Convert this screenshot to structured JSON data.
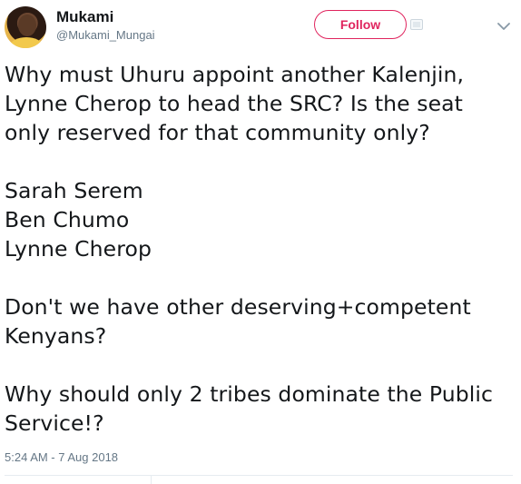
{
  "user": {
    "name": "Mukami",
    "handle": "@Mukami_Mungai"
  },
  "actions": {
    "follow_label": "Follow"
  },
  "tweet": {
    "lines": [
      "Why must Uhuru appoint another Kalenjin,",
      "Lynne Cherop to head the SRC?  Is the seat",
      "only reserved for that community only?",
      "Sarah Serem",
      "Ben Chumo",
      "Lynne Cherop",
      "Don't we have other deserving+competent",
      "Kenyans?",
      "Why should only 2 tribes dominate the Public",
      "Service!?"
    ],
    "timestamp": "5:24 AM - 7 Aug 2018"
  },
  "colors": {
    "accent": "#e0245e",
    "secondary_text": "#657786",
    "primary_text": "#14171a",
    "divider": "#e6ecf0"
  },
  "icons": {
    "extra": "screenshot-badge-icon",
    "menu": "chevron-down-icon"
  }
}
